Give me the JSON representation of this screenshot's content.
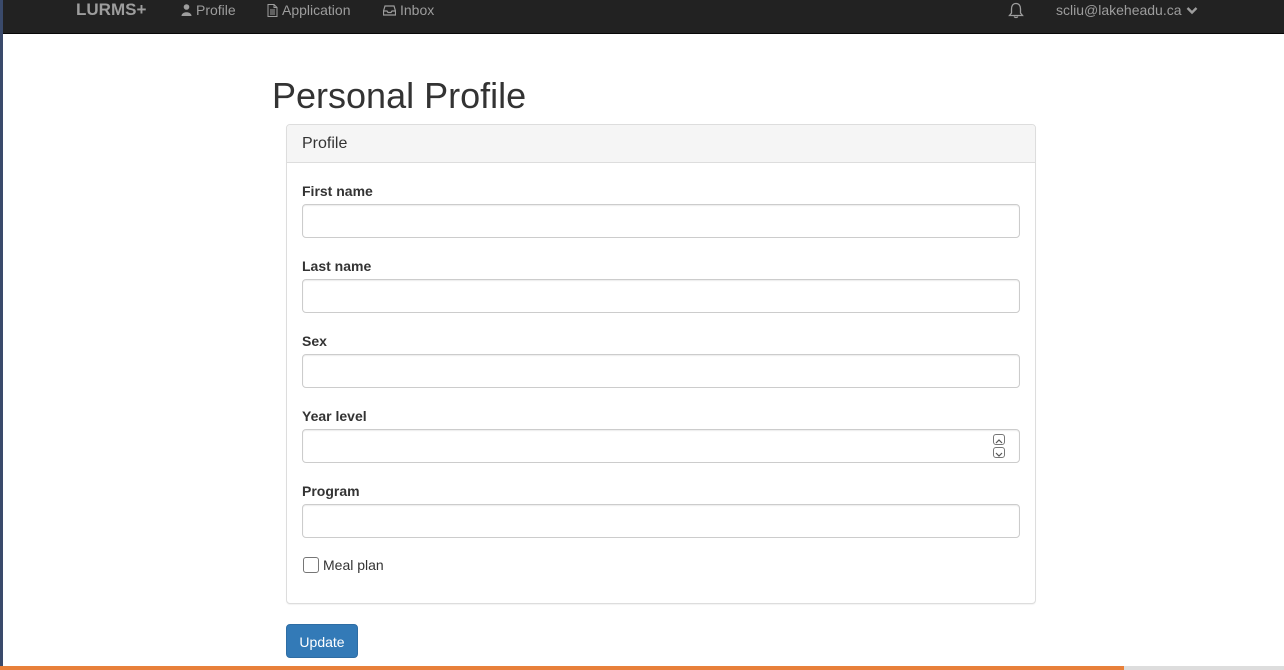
{
  "navbar": {
    "brand": "LURMS+",
    "links": [
      {
        "label": "Profile",
        "icon": "user-icon"
      },
      {
        "label": "Application",
        "icon": "document-icon"
      },
      {
        "label": "Inbox",
        "icon": "inbox-icon"
      }
    ],
    "notification_icon": "bell-icon",
    "user_email": "scliu@lakeheadu.ca",
    "user_dropdown_icon": "chevron-down-icon"
  },
  "page": {
    "title": "Personal Profile"
  },
  "panel": {
    "heading": "Profile",
    "fields": [
      {
        "label": "First name",
        "value": ""
      },
      {
        "label": "Last name",
        "value": ""
      },
      {
        "label": "Sex",
        "value": ""
      },
      {
        "label": "Year level",
        "value": ""
      },
      {
        "label": "Program",
        "value": ""
      }
    ],
    "meal_plan": {
      "label": "Meal plan",
      "checked": false
    }
  },
  "actions": {
    "update_label": "Update"
  },
  "colors": {
    "navbar_bg": "#222222",
    "nav_text": "#9d9d9d",
    "primary": "#337ab7",
    "bottom_bar": "#e8803a"
  }
}
